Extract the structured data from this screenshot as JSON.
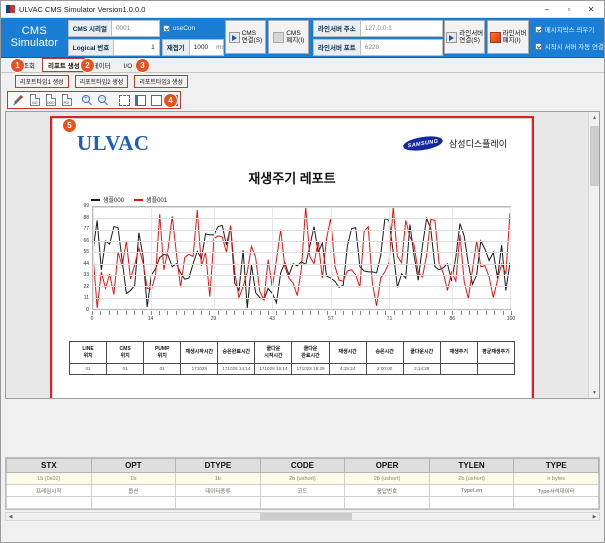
{
  "window": {
    "title": "ULVAC CMS Simulator Version1.0.0.0",
    "minimize": "–",
    "maximize": "▫",
    "close": "✕"
  },
  "header": {
    "brand_line1": "CMS",
    "brand_line2": "Simulator",
    "fields": {
      "cms_serial_label": "CMS 시리얼",
      "cms_serial_value": "0001",
      "logical_no_label": "Logical 번호",
      "logical_no_value": "1",
      "usecon_label": "useCon",
      "retry_label": "재접기",
      "retry_value": "1000",
      "retry_unit": "ms",
      "server_addr_label": "라인서버 주소",
      "server_addr_value": "127.0.0.1",
      "server_port_label": "라인서버 포트",
      "server_port_value": "6228"
    },
    "buttons": {
      "cms_connect": [
        "CMS",
        "연결(S)"
      ],
      "cms_stop": [
        "CMS",
        "폐지(I)"
      ],
      "server_connect": [
        "라인서버",
        "연결(S)"
      ],
      "server_stop": [
        "라인서버",
        "폐지(I)"
      ]
    },
    "checkboxes": [
      {
        "label": "메시지박스 띄우기",
        "checked": true
      },
      {
        "label": "시작시 서버 자동 연결",
        "checked": true
      }
    ]
  },
  "tabs": [
    {
      "label": "조회",
      "active": false
    },
    {
      "label": "리포트 생성",
      "active": true
    },
    {
      "label": "데이터",
      "active": false
    },
    {
      "label": "I/O 상태",
      "active": false
    }
  ],
  "report_type_buttons": [
    "리포트타입1 생성",
    "리포트타입2 생성",
    "리포트타입3 생성"
  ],
  "toolbar": {
    "icons": [
      {
        "name": "print-icon",
        "tag": ""
      },
      {
        "name": "export-xls-icon",
        "tag": "XLS"
      },
      {
        "name": "export-doc-icon",
        "tag": "DOC"
      },
      {
        "name": "export-pdf-icon",
        "tag": "PDF"
      },
      {
        "name": "zoom-in-icon",
        "tag": "+"
      },
      {
        "name": "zoom-out-icon",
        "tag": "−"
      },
      {
        "name": "fit-page-icon",
        "tag": ""
      },
      {
        "name": "fit-width-icon",
        "tag": ""
      },
      {
        "name": "single-page-icon",
        "tag": ""
      },
      {
        "name": "two-page-icon",
        "tag": ""
      }
    ]
  },
  "report": {
    "logo_left": "ULVAC",
    "logo_right_mark": "SAMSUNG",
    "logo_right_text": "삼성디스플레이",
    "title": "재생주기 레포트",
    "table_headers": [
      "LINE\n위치",
      "CMS\n위치",
      "PUMP\n위치",
      "재생시작시간",
      "승온완료시간",
      "쿨다운\n시작시간",
      "쿨다운\n완료시간",
      "재생시간",
      "승온시간",
      "쿨다운시간",
      "재생주기",
      "평균재생주기"
    ],
    "table_rows": [
      [
        "01",
        "01",
        "01",
        "171028",
        "171028 14:14",
        "171028 16:14",
        "171028 18:29",
        "4:15:24",
        "2:00:00",
        "2:14:28",
        "",
        ""
      ]
    ]
  },
  "chart_data": {
    "type": "line",
    "title": "",
    "xlabel": "",
    "ylabel": "",
    "legend": [
      {
        "name": "샘플000",
        "color": "#1a1a1a"
      },
      {
        "name": "샘플001",
        "color": "#ee1111"
      }
    ],
    "legend_position": "top-left",
    "grid": true,
    "ylim": [
      0,
      99
    ],
    "yticks": [
      0,
      11,
      22,
      33,
      44,
      55,
      66,
      77,
      88,
      99
    ],
    "xlim": [
      0,
      100
    ],
    "xticks": [
      0,
      14,
      29,
      43,
      57,
      71,
      86,
      100
    ],
    "series": [
      {
        "name": "샘플000",
        "color": "#1a1a1a",
        "values": [
          57,
          86,
          38,
          66,
          63,
          80,
          79,
          47,
          15,
          18,
          23,
          74,
          51,
          2,
          33,
          39,
          50,
          53,
          52,
          41,
          44,
          35,
          29,
          30,
          44,
          56,
          49,
          73,
          72,
          72,
          80,
          81,
          62,
          80,
          25,
          18,
          57,
          1,
          43,
          16,
          11,
          9,
          20,
          15,
          6,
          35,
          45,
          33,
          44,
          42,
          46,
          43,
          61,
          80,
          55,
          64,
          32,
          30,
          27,
          21,
          23,
          61,
          78,
          79,
          41,
          37,
          36,
          36,
          35,
          52,
          88,
          86,
          55,
          21,
          34,
          30,
          82,
          52,
          28,
          61,
          88,
          78,
          41,
          38,
          40,
          44,
          27,
          50,
          83,
          71,
          44,
          24,
          33,
          66,
          58,
          47,
          55,
          30,
          62,
          18,
          45
        ]
      },
      {
        "name": "샘플001",
        "color": "#ee1111",
        "values": [
          53,
          1,
          36,
          20,
          34,
          14,
          55,
          42,
          66,
          29,
          43,
          59,
          45,
          20,
          19,
          33,
          92,
          38,
          58,
          90,
          54,
          21,
          50,
          53,
          51,
          96,
          42,
          55,
          12,
          68,
          71,
          70,
          55,
          81,
          36,
          11,
          22,
          36,
          61,
          50,
          17,
          9,
          48,
          21,
          48,
          77,
          41,
          30,
          25,
          13,
          40,
          99,
          51,
          44,
          66,
          30,
          68,
          88,
          42,
          28,
          27,
          37,
          38,
          33,
          21,
          75,
          80,
          25,
          3,
          30,
          36,
          45,
          99,
          51,
          45,
          86,
          70,
          62,
          35,
          31,
          52,
          87,
          86,
          44,
          35,
          18,
          36,
          27,
          72,
          27,
          10,
          38,
          66,
          41,
          42,
          31,
          11,
          28,
          44,
          34,
          93
        ]
      }
    ]
  },
  "protocol_table": {
    "headers": [
      "STX",
      "OPT",
      "DTYPE",
      "CODE",
      "OPER",
      "TYLEN",
      "TYPE"
    ],
    "rows": [
      [
        "1b (0x02)",
        "1b",
        "1b",
        "2b (ushort)",
        "2b (ushort)",
        "2b (ushort)",
        "n bytes"
      ],
      [
        "프레임시작",
        "옵션",
        "데이터종류",
        "코드",
        "응답번호",
        "TypeLen",
        "Type서석데이터"
      ],
      [
        "",
        "",
        "",
        "",
        "",
        "",
        ""
      ]
    ]
  },
  "markers": [
    {
      "id": "1",
      "x": 10,
      "y": 58
    },
    {
      "id": "2",
      "x": 80,
      "y": 58
    },
    {
      "id": "3",
      "x": 135,
      "y": 58
    },
    {
      "id": "4",
      "x": 163,
      "y": 93
    },
    {
      "id": "5",
      "x": 62,
      "y": 118
    }
  ],
  "colors": {
    "accent_blue": "#1a7fd4",
    "marker_orange": "#e8501e",
    "highlight_red": "#e02020",
    "series_black": "#1a1a1a",
    "series_red": "#ee1111"
  }
}
